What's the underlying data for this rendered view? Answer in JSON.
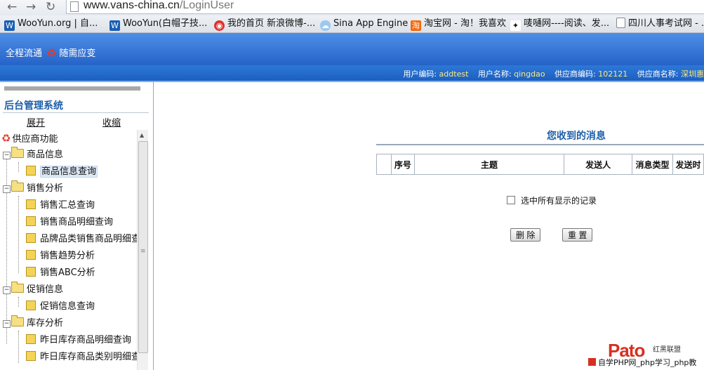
{
  "browser": {
    "url_host": "www.vans-china.cn",
    "url_path": "/LoginUser",
    "bookmarks": [
      {
        "label": "WooYun.org | 自...",
        "icon": "wooyun-icon"
      },
      {
        "label": "WooYun(白帽子技...",
        "icon": "wooyun-icon"
      },
      {
        "label": "我的首页 新浪微博-...",
        "icon": "weibo-icon"
      },
      {
        "label": "Sina App Engine",
        "icon": "cloud-icon"
      },
      {
        "label": "淘宝网 - 淘！我喜欢",
        "icon": "taobao-icon"
      },
      {
        "label": "唛嗵网----阅读、发...",
        "icon": "bird-icon"
      },
      {
        "label": "四川人事考试网 - ...",
        "icon": "page-icon"
      }
    ]
  },
  "header": {
    "slogan_left": "全程流通",
    "slogan_right": "随需应变"
  },
  "user_info": {
    "user_code_label": "用户编码:",
    "user_code": "addtest",
    "user_name_label": "用户名称:",
    "user_name": "qingdao",
    "supplier_code_label": "供应商编码:",
    "supplier_code": "102121",
    "supplier_name_label": "供应商名称:",
    "supplier_name": "深圳惠"
  },
  "sidebar": {
    "title": "后台管理系统",
    "expand_label": "展开",
    "collapse_label": "收缩",
    "root_label": "供应商功能",
    "groups": [
      {
        "label": "商品信息",
        "items": [
          "商品信息查询"
        ]
      },
      {
        "label": "销售分析",
        "items": [
          "销售汇总查询",
          "销售商品明细查询",
          "品牌品类销售商品明细查",
          "销售趋势分析",
          "销售ABC分析"
        ]
      },
      {
        "label": "促销信息",
        "items": [
          "促销信息查询"
        ]
      },
      {
        "label": "库存分析",
        "items": [
          "昨日库存商品明细查询",
          "昨日库存商品类别明细查"
        ]
      }
    ]
  },
  "messages": {
    "title": "您收到的消息",
    "columns": [
      "",
      "序号",
      "主题",
      "发送人",
      "消息类型",
      "发送时"
    ],
    "select_all_label": "选中所有显示的记录",
    "delete_label": "删 除",
    "reset_label": "重 置"
  },
  "watermark": {
    "logo_text": "Pato",
    "side_text": "红黑联盟",
    "bottom_text": "自学PHP网_php学习_php教"
  }
}
